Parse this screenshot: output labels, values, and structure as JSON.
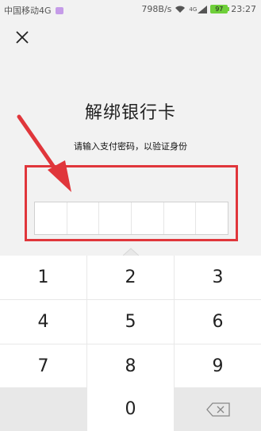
{
  "status_bar": {
    "carrier": "中国移动4G",
    "speed": "798B/s",
    "network": "4G",
    "battery": "97",
    "time": "23:27"
  },
  "dialog": {
    "title": "解绑银行卡",
    "subtitle": "请输入支付密码，以验证身份",
    "password_digits": [
      "",
      "",
      "",
      "",
      "",
      ""
    ]
  },
  "keypad": {
    "keys": [
      "1",
      "2",
      "3",
      "4",
      "5",
      "6",
      "7",
      "8",
      "9",
      "",
      "0",
      ""
    ]
  },
  "icons": {
    "close": "close-icon",
    "backspace": "backspace-icon",
    "arrow": "annotation-arrow"
  },
  "colors": {
    "annotation": "#e0363b",
    "battery": "#6fcf3a"
  }
}
